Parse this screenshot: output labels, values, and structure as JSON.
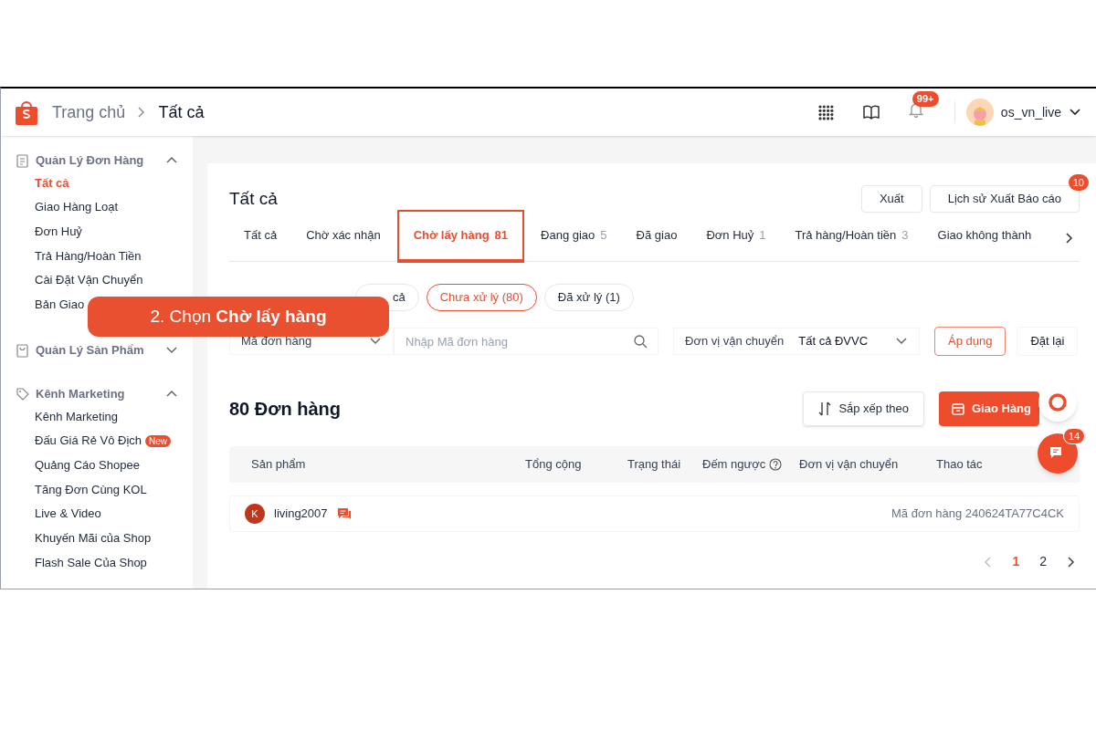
{
  "header": {
    "breadcrumb": [
      "Trang chủ",
      "Tất cả"
    ],
    "notification_badge": "99+",
    "username": "os_vn_live"
  },
  "sidebar": {
    "sections": [
      {
        "title": "Quản Lý Đơn Hàng",
        "expanded": true,
        "items": [
          {
            "label": "Tất cả",
            "selected": true
          },
          {
            "label": "Giao Hàng Loạt",
            "selected": false
          },
          {
            "label": "Đơn Huỷ",
            "selected": false
          },
          {
            "label": "Trả Hàng/Hoàn Tiền",
            "selected": false
          },
          {
            "label": "Cài Đặt Vận Chuyển",
            "selected": false
          },
          {
            "label": "Bản Giao",
            "selected": false
          }
        ]
      },
      {
        "title": "Quản Lý Sản Phẩm",
        "expanded": false
      },
      {
        "title": "Kênh Marketing",
        "expanded": true,
        "items": [
          {
            "label": "Kênh Marketing",
            "selected": false
          },
          {
            "label": "Đấu Giá Rẻ Vô Địch",
            "badge": "New",
            "selected": false
          },
          {
            "label": "Quảng Cáo Shopee",
            "selected": false
          },
          {
            "label": "Tăng Đơn Cùng KOL",
            "selected": false
          },
          {
            "label": "Live & Video",
            "selected": false
          },
          {
            "label": "Khuyến Mãi của Shop",
            "selected": false
          },
          {
            "label": "Flash Sale Của Shop",
            "selected": false
          }
        ]
      }
    ]
  },
  "page": {
    "title": "Tất cả",
    "actions": [
      {
        "label": "Xuất"
      },
      {
        "label": "Lịch sử Xuất Báo cáo",
        "badge": "10"
      }
    ],
    "tabs": [
      {
        "label": "Tất cả",
        "selected": false
      },
      {
        "label": "Chờ xác nhận",
        "selected": false
      },
      {
        "label": "Chờ lấy hàng",
        "count": "81",
        "selected": true
      },
      {
        "label": "Đang giao",
        "count": "5",
        "selected": false
      },
      {
        "label": "Đã giao",
        "selected": false
      },
      {
        "label": "Đơn Huỷ",
        "count": "1",
        "selected": false
      },
      {
        "label": "Trả hàng/Hoàn tiền",
        "count": "3",
        "selected": false
      },
      {
        "label": "Giao không thành",
        "selected": false
      }
    ],
    "status_chips": [
      {
        "label": "cả",
        "selected": false
      },
      {
        "label": "Chưa xử lý (80)",
        "selected": true
      },
      {
        "label": "Đã xử lý (1)",
        "selected": false
      }
    ],
    "search_type": "Mã đơn hàng",
    "search": {
      "placeholder": "Nhập Mã đơn hàng"
    },
    "carrier": {
      "label": "Đơn vị vận chuyển",
      "value": "Tất cả ĐVVC"
    },
    "apply": "Áp dụng",
    "reset": "Đặt lại",
    "order_count": "80 Đơn hàng",
    "sort": "Sắp xếp theo",
    "ship": "Giao Hàng",
    "columns": [
      "Sản phẩm",
      "Tổng cộng",
      "Trạng thái",
      "Đếm ngược",
      "Đơn vị vận chuyển",
      "Thao tác"
    ],
    "orders": [
      {
        "avatar": "K",
        "buyer": "living2007",
        "order_id": "Mã đơn hàng 240624TA77C4CK"
      }
    ],
    "pages": [
      {
        "label": "1",
        "selected": true
      },
      {
        "label": "2",
        "selected": false
      }
    ],
    "chat_badge": "14"
  },
  "callout": {
    "text": "2. Chọn **Chờ lấy hàng**"
  }
}
